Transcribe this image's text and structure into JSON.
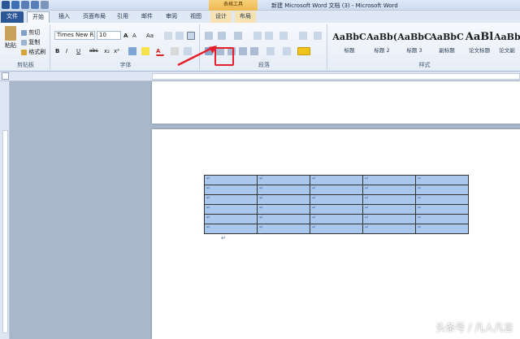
{
  "window": {
    "title": "新建 Microsoft Word 文档 (3) - Microsoft Word",
    "context_tools": "表格工具"
  },
  "tabs": [
    {
      "label": "文件"
    },
    {
      "label": "开始"
    },
    {
      "label": "插入"
    },
    {
      "label": "页面布局"
    },
    {
      "label": "引用"
    },
    {
      "label": "邮件"
    },
    {
      "label": "审阅"
    },
    {
      "label": "视图"
    },
    {
      "label": "设计"
    },
    {
      "label": "布局"
    }
  ],
  "clipboard": {
    "paste": "粘贴",
    "cut": "剪切",
    "copy": "复制",
    "format_painter": "格式刷",
    "group_label": "剪贴板"
  },
  "font": {
    "name": "Times New R",
    "size": "10",
    "grow": "A",
    "shrink": "A",
    "case": "Aa",
    "bold": "B",
    "italic": "I",
    "underline": "U",
    "strike": "abc",
    "sub": "x₂",
    "sup": "x²",
    "color_a": "A",
    "group_label": "字体"
  },
  "paragraph": {
    "group_label": "段落"
  },
  "styles": {
    "items": [
      {
        "sample": "AaBbC",
        "name": "标题"
      },
      {
        "sample": "AaBb(",
        "name": "标题 2"
      },
      {
        "sample": "AaBbC",
        "name": "标题 3"
      },
      {
        "sample": "AaBbC",
        "name": "副标题"
      },
      {
        "sample": "AaBl",
        "name": "论文标题"
      },
      {
        "sample": "AaBbC",
        "name": "论文副"
      }
    ],
    "group_label": "样式"
  },
  "table": {
    "rows": 6,
    "cols": 5,
    "cell_mark": "↵"
  },
  "after_table_mark": "↵",
  "watermark": "头条号 / 凡人凡言",
  "colors": {
    "accent": "#2b5797",
    "cell_fill": "#a9c8ec",
    "highlight": "#e3202b"
  }
}
